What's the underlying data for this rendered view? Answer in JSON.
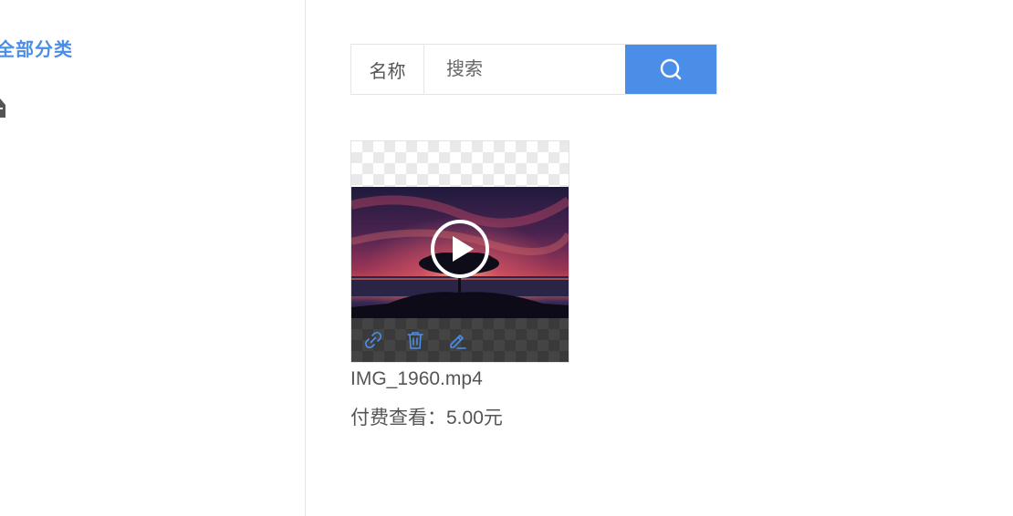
{
  "sidebar": {
    "category_all": "全部分类"
  },
  "search": {
    "label": "名称",
    "placeholder": "搜索"
  },
  "media": {
    "file_name": "IMG_1960.mp4",
    "price_label": "付费查看：",
    "price_value": "5.00元"
  },
  "icons": [
    "folder-icon",
    "search-icon",
    "play-icon",
    "link-icon",
    "trash-icon",
    "edit-icon"
  ],
  "colors": {
    "accent": "#4a8ee8",
    "sidebar_border": "#e6e6e6",
    "text": "#555555"
  }
}
